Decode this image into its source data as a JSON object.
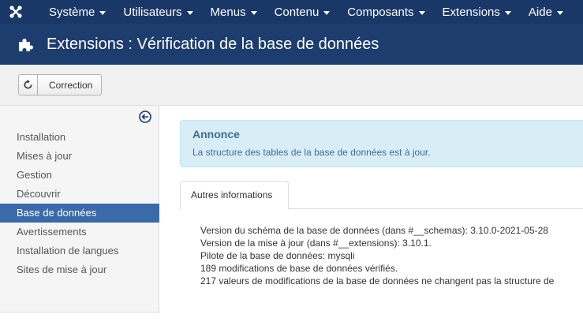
{
  "topnav": {
    "logo_icon": "joomla-logo-icon",
    "menus": [
      {
        "label": "Système"
      },
      {
        "label": "Utilisateurs"
      },
      {
        "label": "Menus"
      },
      {
        "label": "Contenu"
      },
      {
        "label": "Composants"
      },
      {
        "label": "Extensions"
      },
      {
        "label": "Aide"
      }
    ]
  },
  "header": {
    "icon": "puzzle-piece-icon",
    "title": "Extensions : Vérification de la base de données"
  },
  "toolbar": {
    "correction_label": "Correction",
    "correction_icon": "refresh-icon"
  },
  "sidebar": {
    "toggle_icon": "collapse-arrow-icon",
    "items": [
      {
        "label": "Installation"
      },
      {
        "label": "Mises à jour"
      },
      {
        "label": "Gestion"
      },
      {
        "label": "Découvrir"
      },
      {
        "label": "Base de données"
      },
      {
        "label": "Avertissements"
      },
      {
        "label": "Installation de langues"
      },
      {
        "label": "Sites de mise à jour"
      }
    ],
    "active_index": 4
  },
  "alert": {
    "title": "Annonce",
    "text": "La structure des tables de la base de données est à jour."
  },
  "tabs": [
    {
      "label": "Autres informations"
    }
  ],
  "info": [
    "Version du schéma de la base de données (dans #__schemas): 3.10.0-2021-05-28",
    "Version de la mise à jour (dans #__extensions): 3.10.1.",
    "Pilote de la base de données: mysqli",
    "189 modifications de base de données vérifiés.",
    "217 valeurs de modifications de la base de données ne changent pas la structure de"
  ],
  "colors": {
    "navbar": "#1a3867",
    "header": "#1c3d6e",
    "active": "#3a6aa8",
    "alert_bg": "#d9edf7",
    "alert_text": "#3a6f8f"
  }
}
